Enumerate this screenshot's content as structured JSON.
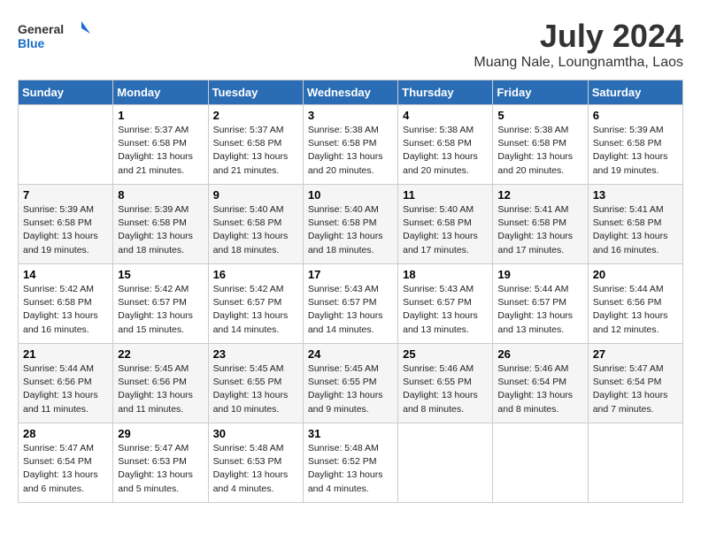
{
  "header": {
    "logo_general": "General",
    "logo_blue": "Blue",
    "month_year": "July 2024",
    "location": "Muang Nale, Loungnamtha, Laos"
  },
  "calendar": {
    "days_of_week": [
      "Sunday",
      "Monday",
      "Tuesday",
      "Wednesday",
      "Thursday",
      "Friday",
      "Saturday"
    ],
    "weeks": [
      [
        {
          "day": "",
          "info": ""
        },
        {
          "day": "1",
          "info": "Sunrise: 5:37 AM\nSunset: 6:58 PM\nDaylight: 13 hours\nand 21 minutes."
        },
        {
          "day": "2",
          "info": "Sunrise: 5:37 AM\nSunset: 6:58 PM\nDaylight: 13 hours\nand 21 minutes."
        },
        {
          "day": "3",
          "info": "Sunrise: 5:38 AM\nSunset: 6:58 PM\nDaylight: 13 hours\nand 20 minutes."
        },
        {
          "day": "4",
          "info": "Sunrise: 5:38 AM\nSunset: 6:58 PM\nDaylight: 13 hours\nand 20 minutes."
        },
        {
          "day": "5",
          "info": "Sunrise: 5:38 AM\nSunset: 6:58 PM\nDaylight: 13 hours\nand 20 minutes."
        },
        {
          "day": "6",
          "info": "Sunrise: 5:39 AM\nSunset: 6:58 PM\nDaylight: 13 hours\nand 19 minutes."
        }
      ],
      [
        {
          "day": "7",
          "info": "Sunrise: 5:39 AM\nSunset: 6:58 PM\nDaylight: 13 hours\nand 19 minutes."
        },
        {
          "day": "8",
          "info": "Sunrise: 5:39 AM\nSunset: 6:58 PM\nDaylight: 13 hours\nand 18 minutes."
        },
        {
          "day": "9",
          "info": "Sunrise: 5:40 AM\nSunset: 6:58 PM\nDaylight: 13 hours\nand 18 minutes."
        },
        {
          "day": "10",
          "info": "Sunrise: 5:40 AM\nSunset: 6:58 PM\nDaylight: 13 hours\nand 18 minutes."
        },
        {
          "day": "11",
          "info": "Sunrise: 5:40 AM\nSunset: 6:58 PM\nDaylight: 13 hours\nand 17 minutes."
        },
        {
          "day": "12",
          "info": "Sunrise: 5:41 AM\nSunset: 6:58 PM\nDaylight: 13 hours\nand 17 minutes."
        },
        {
          "day": "13",
          "info": "Sunrise: 5:41 AM\nSunset: 6:58 PM\nDaylight: 13 hours\nand 16 minutes."
        }
      ],
      [
        {
          "day": "14",
          "info": "Sunrise: 5:42 AM\nSunset: 6:58 PM\nDaylight: 13 hours\nand 16 minutes."
        },
        {
          "day": "15",
          "info": "Sunrise: 5:42 AM\nSunset: 6:57 PM\nDaylight: 13 hours\nand 15 minutes."
        },
        {
          "day": "16",
          "info": "Sunrise: 5:42 AM\nSunset: 6:57 PM\nDaylight: 13 hours\nand 14 minutes."
        },
        {
          "day": "17",
          "info": "Sunrise: 5:43 AM\nSunset: 6:57 PM\nDaylight: 13 hours\nand 14 minutes."
        },
        {
          "day": "18",
          "info": "Sunrise: 5:43 AM\nSunset: 6:57 PM\nDaylight: 13 hours\nand 13 minutes."
        },
        {
          "day": "19",
          "info": "Sunrise: 5:44 AM\nSunset: 6:57 PM\nDaylight: 13 hours\nand 13 minutes."
        },
        {
          "day": "20",
          "info": "Sunrise: 5:44 AM\nSunset: 6:56 PM\nDaylight: 13 hours\nand 12 minutes."
        }
      ],
      [
        {
          "day": "21",
          "info": "Sunrise: 5:44 AM\nSunset: 6:56 PM\nDaylight: 13 hours\nand 11 minutes."
        },
        {
          "day": "22",
          "info": "Sunrise: 5:45 AM\nSunset: 6:56 PM\nDaylight: 13 hours\nand 11 minutes."
        },
        {
          "day": "23",
          "info": "Sunrise: 5:45 AM\nSunset: 6:55 PM\nDaylight: 13 hours\nand 10 minutes."
        },
        {
          "day": "24",
          "info": "Sunrise: 5:45 AM\nSunset: 6:55 PM\nDaylight: 13 hours\nand 9 minutes."
        },
        {
          "day": "25",
          "info": "Sunrise: 5:46 AM\nSunset: 6:55 PM\nDaylight: 13 hours\nand 8 minutes."
        },
        {
          "day": "26",
          "info": "Sunrise: 5:46 AM\nSunset: 6:54 PM\nDaylight: 13 hours\nand 8 minutes."
        },
        {
          "day": "27",
          "info": "Sunrise: 5:47 AM\nSunset: 6:54 PM\nDaylight: 13 hours\nand 7 minutes."
        }
      ],
      [
        {
          "day": "28",
          "info": "Sunrise: 5:47 AM\nSunset: 6:54 PM\nDaylight: 13 hours\nand 6 minutes."
        },
        {
          "day": "29",
          "info": "Sunrise: 5:47 AM\nSunset: 6:53 PM\nDaylight: 13 hours\nand 5 minutes."
        },
        {
          "day": "30",
          "info": "Sunrise: 5:48 AM\nSunset: 6:53 PM\nDaylight: 13 hours\nand 4 minutes."
        },
        {
          "day": "31",
          "info": "Sunrise: 5:48 AM\nSunset: 6:52 PM\nDaylight: 13 hours\nand 4 minutes."
        },
        {
          "day": "",
          "info": ""
        },
        {
          "day": "",
          "info": ""
        },
        {
          "day": "",
          "info": ""
        }
      ]
    ]
  }
}
